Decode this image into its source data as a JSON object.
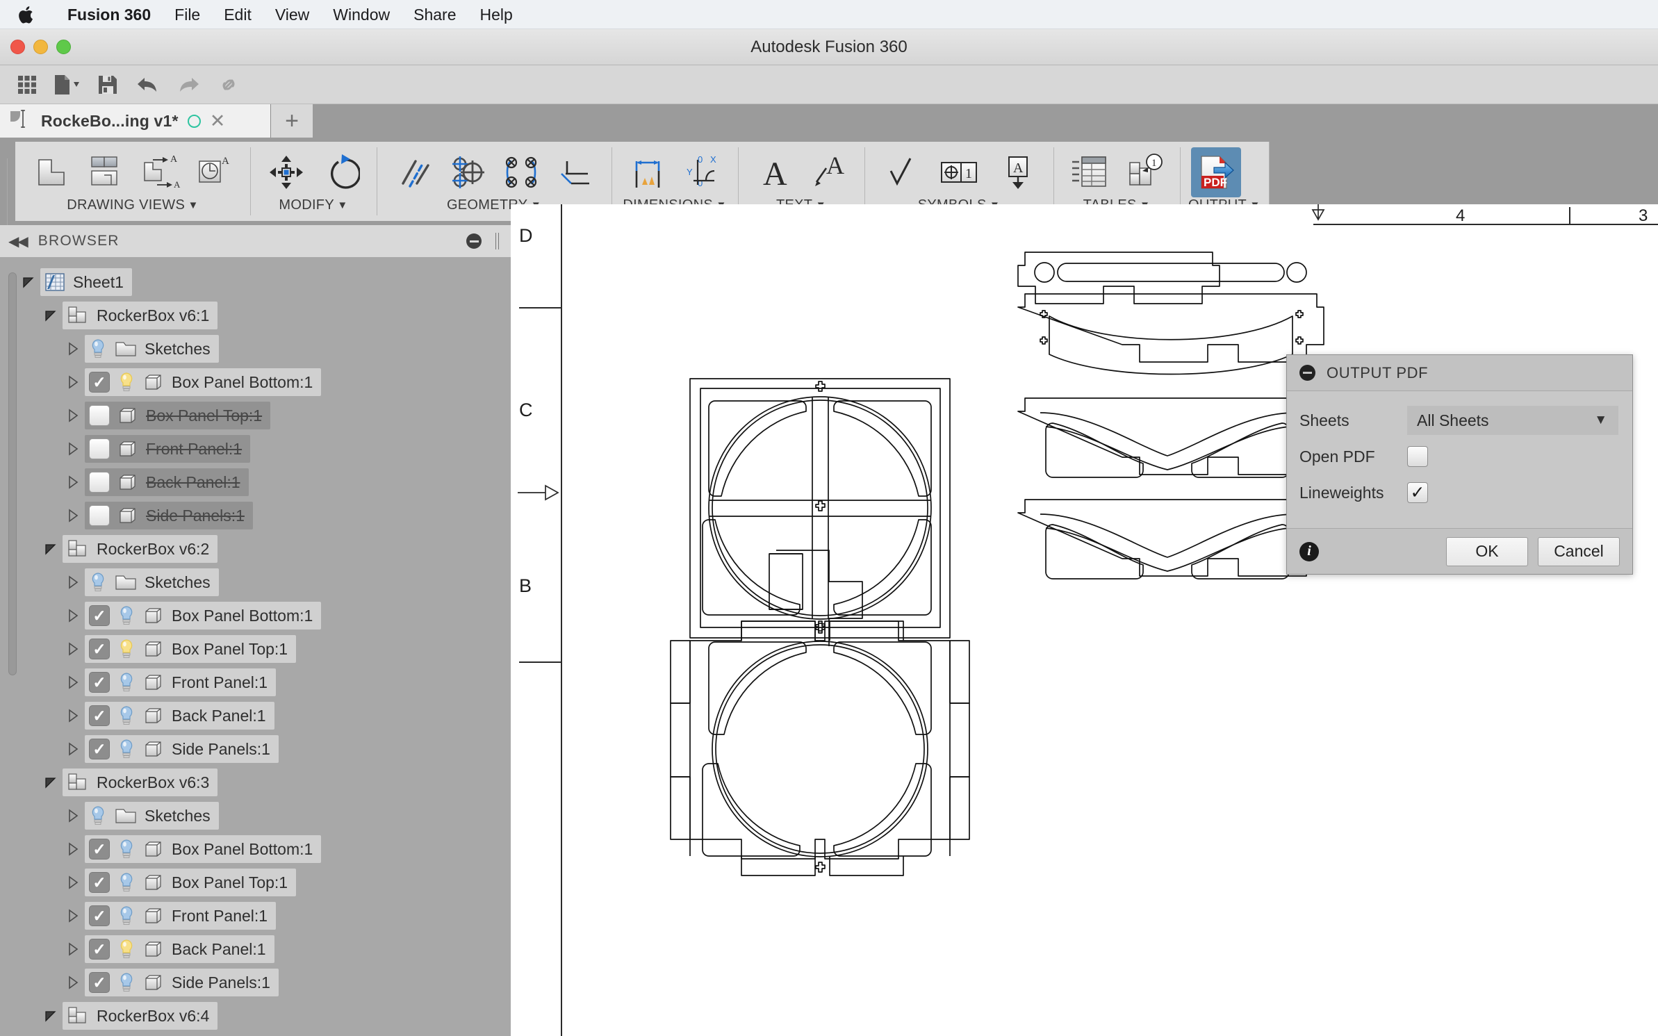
{
  "macmenu": {
    "apple_icon": "apple-logo-icon",
    "items": [
      {
        "label": "Fusion 360",
        "bold": true
      },
      {
        "label": "File",
        "bold": false
      },
      {
        "label": "Edit",
        "bold": false
      },
      {
        "label": "View",
        "bold": false
      },
      {
        "label": "Window",
        "bold": false
      },
      {
        "label": "Share",
        "bold": false
      },
      {
        "label": "Help",
        "bold": false
      }
    ]
  },
  "window": {
    "title": "Autodesk Fusion 360",
    "traffic_lights": [
      "close-button",
      "minimize-button",
      "zoom-button"
    ]
  },
  "quick_toolbar": {
    "buttons": [
      {
        "name": "show-data-panel-icon"
      },
      {
        "name": "file-menu-icon"
      },
      {
        "name": "save-icon"
      },
      {
        "name": "undo-icon"
      },
      {
        "name": "redo-icon"
      },
      {
        "name": "link-icon"
      }
    ]
  },
  "tabs": {
    "document": {
      "label": "RockeBo...ing v1*",
      "status_icon": "sync-circle-icon",
      "close_icon": "close-icon"
    },
    "new_tab_label": "+"
  },
  "ribbon": {
    "panels": [
      {
        "label": "DRAWING VIEWS",
        "caret": "▼",
        "icons": [
          "base-view-icon",
          "projected-view-icon",
          "section-view-icon",
          "detail-view-icon"
        ]
      },
      {
        "label": "MODIFY",
        "caret": "▼",
        "icons": [
          "move-icon",
          "rotate-icon"
        ]
      },
      {
        "label": "GEOMETRY",
        "caret": "▼",
        "icons": [
          "centerline-icon",
          "center-mark-icon",
          "center-mark-pattern-icon",
          "edge-extension-icon"
        ]
      },
      {
        "label": "DIMENSIONS",
        "caret": "▼",
        "icons": [
          "dimension-icon",
          "ordinate-dimension-icon"
        ]
      },
      {
        "label": "TEXT",
        "caret": "▼",
        "icons": [
          "text-icon",
          "leader-text-icon"
        ]
      },
      {
        "label": "SYMBOLS",
        "caret": "▼",
        "icons": [
          "surface-texture-icon",
          "feature-control-frame-icon",
          "datum-identifier-icon"
        ]
      },
      {
        "label": "TABLES",
        "caret": "▼",
        "icons": [
          "table-icon",
          "balloon-icon"
        ]
      },
      {
        "label": "OUTPUT",
        "caret": "▼",
        "icons": [
          "output-pdf-icon"
        ]
      }
    ]
  },
  "browser": {
    "title": "BROWSER",
    "collapse_icon": "collapse-left-icon",
    "minimize_icon": "minimize-icon",
    "grip_icon": "panel-grip-icon",
    "tree": [
      {
        "indent": 0,
        "label": "Sheet1",
        "twisty": "expanded",
        "icon": "sheet-icon",
        "checkbox": "none",
        "bulb": "none",
        "state": "on"
      },
      {
        "indent": 1,
        "label": "RockerBox v6:1",
        "twisty": "expanded",
        "icon": "assembly-icon",
        "checkbox": "none",
        "bulb": "none",
        "state": "on"
      },
      {
        "indent": 2,
        "label": "Sketches",
        "twisty": "collapsed",
        "icon": "folder-icon",
        "checkbox": "none",
        "bulb": "blue",
        "state": "on"
      },
      {
        "indent": 2,
        "label": "Box Panel Bottom:1",
        "twisty": "collapsed",
        "icon": "body-icon",
        "checkbox": "checked",
        "bulb": "yellow",
        "state": "on"
      },
      {
        "indent": 2,
        "label": "Box Panel Top:1",
        "twisty": "collapsed",
        "icon": "body-icon",
        "checkbox": "unchecked",
        "bulb": "none",
        "state": "off"
      },
      {
        "indent": 2,
        "label": "Front Panel:1",
        "twisty": "collapsed",
        "icon": "body-icon",
        "checkbox": "unchecked",
        "bulb": "none",
        "state": "off"
      },
      {
        "indent": 2,
        "label": "Back Panel:1",
        "twisty": "collapsed",
        "icon": "body-icon",
        "checkbox": "unchecked",
        "bulb": "none",
        "state": "off"
      },
      {
        "indent": 2,
        "label": "Side Panels:1",
        "twisty": "collapsed",
        "icon": "body-icon",
        "checkbox": "unchecked",
        "bulb": "none",
        "state": "off"
      },
      {
        "indent": 1,
        "label": "RockerBox v6:2",
        "twisty": "expanded",
        "icon": "assembly-icon",
        "checkbox": "none",
        "bulb": "none",
        "state": "on"
      },
      {
        "indent": 2,
        "label": "Sketches",
        "twisty": "collapsed",
        "icon": "folder-icon",
        "checkbox": "none",
        "bulb": "blue",
        "state": "on"
      },
      {
        "indent": 2,
        "label": "Box Panel Bottom:1",
        "twisty": "collapsed",
        "icon": "body-icon",
        "checkbox": "checked",
        "bulb": "blue",
        "state": "on"
      },
      {
        "indent": 2,
        "label": "Box Panel Top:1",
        "twisty": "collapsed",
        "icon": "body-icon",
        "checkbox": "checked",
        "bulb": "yellow",
        "state": "on"
      },
      {
        "indent": 2,
        "label": "Front Panel:1",
        "twisty": "collapsed",
        "icon": "body-icon",
        "checkbox": "checked",
        "bulb": "blue",
        "state": "on"
      },
      {
        "indent": 2,
        "label": "Back Panel:1",
        "twisty": "collapsed",
        "icon": "body-icon",
        "checkbox": "checked",
        "bulb": "blue",
        "state": "on"
      },
      {
        "indent": 2,
        "label": "Side Panels:1",
        "twisty": "collapsed",
        "icon": "body-icon",
        "checkbox": "checked",
        "bulb": "blue",
        "state": "on"
      },
      {
        "indent": 1,
        "label": "RockerBox v6:3",
        "twisty": "expanded",
        "icon": "assembly-icon",
        "checkbox": "none",
        "bulb": "none",
        "state": "on"
      },
      {
        "indent": 2,
        "label": "Sketches",
        "twisty": "collapsed",
        "icon": "folder-icon",
        "checkbox": "none",
        "bulb": "blue",
        "state": "on"
      },
      {
        "indent": 2,
        "label": "Box Panel Bottom:1",
        "twisty": "collapsed",
        "icon": "body-icon",
        "checkbox": "checked",
        "bulb": "blue",
        "state": "on"
      },
      {
        "indent": 2,
        "label": "Box Panel Top:1",
        "twisty": "collapsed",
        "icon": "body-icon",
        "checkbox": "checked",
        "bulb": "blue",
        "state": "on"
      },
      {
        "indent": 2,
        "label": "Front Panel:1",
        "twisty": "collapsed",
        "icon": "body-icon",
        "checkbox": "checked",
        "bulb": "blue",
        "state": "on"
      },
      {
        "indent": 2,
        "label": "Back Panel:1",
        "twisty": "collapsed",
        "icon": "body-icon",
        "checkbox": "checked",
        "bulb": "yellow",
        "state": "on"
      },
      {
        "indent": 2,
        "label": "Side Panels:1",
        "twisty": "collapsed",
        "icon": "body-icon",
        "checkbox": "checked",
        "bulb": "blue",
        "state": "on"
      },
      {
        "indent": 1,
        "label": "RockerBox v6:4",
        "twisty": "expanded",
        "icon": "assembly-icon",
        "checkbox": "none",
        "bulb": "none",
        "state": "on"
      }
    ]
  },
  "sheet": {
    "zone_labels_vertical": [
      "D",
      "C",
      "B"
    ],
    "ruler_numbers_top": [
      "4",
      "3"
    ]
  },
  "dialog": {
    "title": "OUTPUT PDF",
    "minimize_icon": "minimize-icon",
    "rows": {
      "sheets_label": "Sheets",
      "sheets_value": "All Sheets",
      "open_pdf_label": "Open PDF",
      "open_pdf_checked": false,
      "lineweights_label": "Lineweights",
      "lineweights_checked": true
    },
    "info_icon": "info-icon",
    "ok_label": "OK",
    "cancel_label": "Cancel"
  },
  "colors": {
    "accent_blue": "#1f6fd0",
    "ribbon_selected": "#5d8cb3",
    "pdf_red": "#c9211e",
    "tab_sync_green": "#2ec4a0",
    "browser_bg": "#a8a8a8"
  }
}
